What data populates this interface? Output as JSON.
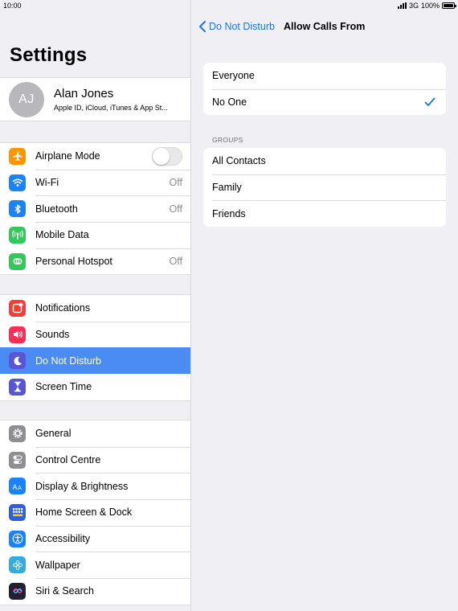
{
  "status_bar": {
    "time": "10:00",
    "network": "3G",
    "battery": "100%"
  },
  "settings": {
    "title": "Settings",
    "profile": {
      "initials": "AJ",
      "name": "Alan Jones",
      "subtitle": "Apple ID, iCloud, iTunes & App St..."
    },
    "group1": [
      {
        "label": "Airplane Mode",
        "icon": "airplane-icon",
        "color": "#ff9500",
        "control": "toggle",
        "on": false
      },
      {
        "label": "Wi-Fi",
        "icon": "wifi-icon",
        "color": "#1a82fb",
        "value": "Off"
      },
      {
        "label": "Bluetooth",
        "icon": "bluetooth-icon",
        "color": "#1a82fb",
        "value": "Off"
      },
      {
        "label": "Mobile Data",
        "icon": "antenna-icon",
        "color": "#34c759"
      },
      {
        "label": "Personal Hotspot",
        "icon": "hotspot-icon",
        "color": "#34c759",
        "value": "Off"
      }
    ],
    "group2": [
      {
        "label": "Notifications",
        "icon": "notifications-icon",
        "color": "#ff3b30"
      },
      {
        "label": "Sounds",
        "icon": "speaker-icon",
        "color": "#ff2d55"
      },
      {
        "label": "Do Not Disturb",
        "icon": "moon-icon",
        "color": "#5856d6",
        "selected": true
      },
      {
        "label": "Screen Time",
        "icon": "hourglass-icon",
        "color": "#5856d6"
      }
    ],
    "group3": [
      {
        "label": "General",
        "icon": "gear-icon",
        "color": "#8e8e93"
      },
      {
        "label": "Control Centre",
        "icon": "switches-icon",
        "color": "#8e8e93"
      },
      {
        "label": "Display & Brightness",
        "icon": "text-size-icon",
        "color": "#1a82fb"
      },
      {
        "label": "Home Screen & Dock",
        "icon": "grid-icon",
        "color": "#2f5fdc"
      },
      {
        "label": "Accessibility",
        "icon": "accessibility-icon",
        "color": "#1a82fb"
      },
      {
        "label": "Wallpaper",
        "icon": "flower-icon",
        "color": "#35aadc"
      },
      {
        "label": "Siri & Search",
        "icon": "siri-icon",
        "color": "#222233"
      }
    ]
  },
  "detail": {
    "back_label": "Do Not Disturb",
    "title": "Allow Calls From",
    "options": [
      {
        "label": "Everyone",
        "checked": false
      },
      {
        "label": "No One",
        "checked": true
      }
    ],
    "groups_header": "GROUPS",
    "groups": [
      {
        "label": "All Contacts"
      },
      {
        "label": "Family"
      },
      {
        "label": "Friends"
      }
    ],
    "accent": "#1a73e8"
  }
}
